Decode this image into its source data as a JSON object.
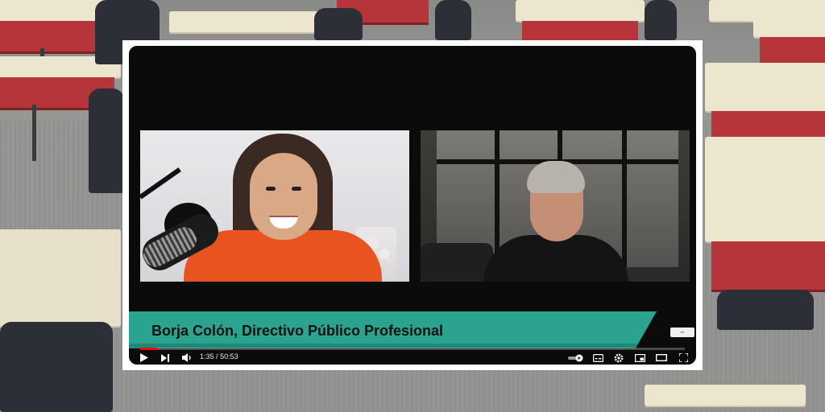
{
  "video": {
    "lower_third": "Borja Colón, Directivo Público Profesional",
    "time_current": "1:35",
    "time_separator": "/",
    "time_total": "50:53",
    "progress_fraction": 0.031
  },
  "colors": {
    "lower_third": "#2aa38f",
    "progress": "#ff0000",
    "player_bg": "#0b0b0b"
  },
  "icons": [
    "play-icon",
    "next-icon",
    "volume-icon",
    "autoplay-toggle-icon",
    "subtitles-icon",
    "settings-icon",
    "miniplayer-icon",
    "theater-mode-icon",
    "fullscreen-icon"
  ]
}
